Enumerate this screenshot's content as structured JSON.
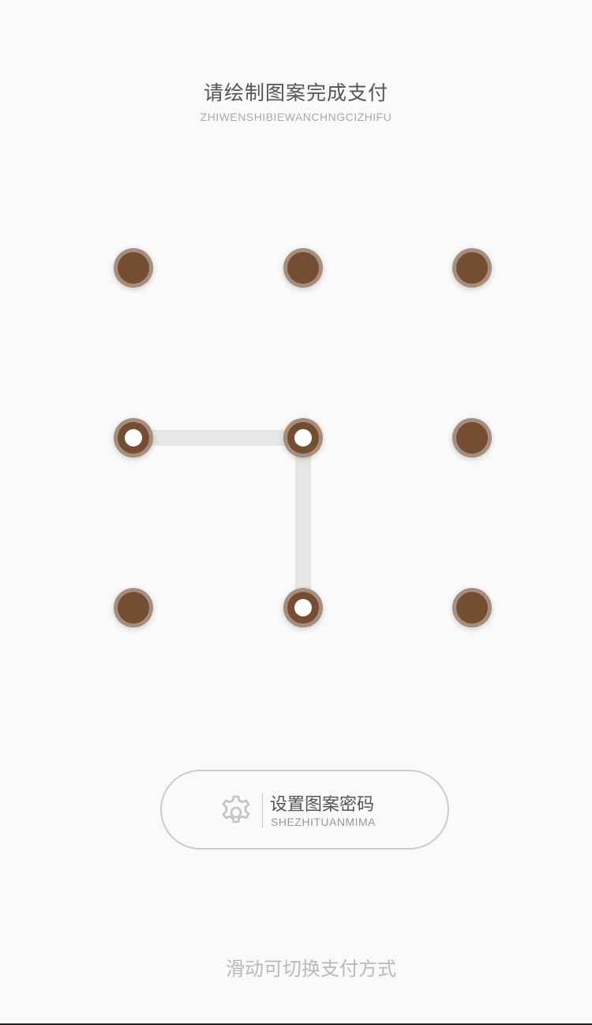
{
  "header": {
    "title": "请绘制图案完成支付",
    "subtitle": "ZHIWENSHIBIEWANCHNGCIZHIFU"
  },
  "pattern": {
    "grid_size": 3,
    "selected_sequence": [
      4,
      5,
      8
    ],
    "colors": {
      "dot_ring": "#a68d7e",
      "dot_core": "#744d33",
      "dot_center": "#ffffff",
      "path_line": "#e6e6e6"
    }
  },
  "settings_button": {
    "icon": "gear-icon",
    "label": "设置图案密码",
    "sublabel": "SHEZHITUANMIMA"
  },
  "footer": {
    "switch_hint": "滑动可切换支付方式"
  }
}
